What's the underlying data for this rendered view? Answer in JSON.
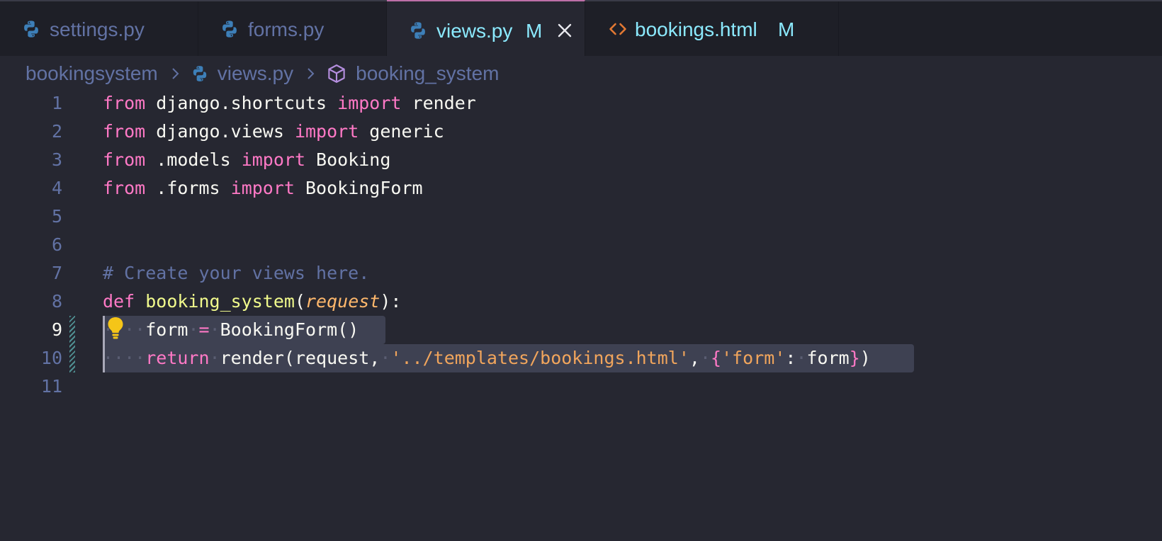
{
  "tabs": [
    {
      "label": "settings.py",
      "modified": "",
      "icon": "python-icon",
      "active": false
    },
    {
      "label": "forms.py",
      "modified": "",
      "icon": "python-icon",
      "active": false
    },
    {
      "label": "views.py",
      "modified": "M",
      "icon": "python-icon",
      "active": true
    },
    {
      "label": "bookings.html",
      "modified": "M",
      "icon": "html-icon",
      "active": false
    }
  ],
  "breadcrumb": {
    "folder": "bookingsystem",
    "file": "views.py",
    "symbol": "booking_system"
  },
  "editor": {
    "language": "python",
    "current_line": 9,
    "line_numbers": [
      "1",
      "2",
      "3",
      "4",
      "5",
      "6",
      "7",
      "8",
      "9",
      "10",
      "11"
    ],
    "code": {
      "l1": {
        "kw1": "from",
        "mod": " django.shortcuts ",
        "kw2": "import",
        "name": " render"
      },
      "l2": {
        "kw1": "from",
        "mod": " django.views ",
        "kw2": "import",
        "name": " generic"
      },
      "l3": {
        "kw1": "from",
        "mod": " .models ",
        "kw2": "import",
        "name": " Booking"
      },
      "l4": {
        "kw1": "from",
        "mod": " .forms ",
        "kw2": "import",
        "name": " BookingForm"
      },
      "l7": {
        "comment": "# Create your views here."
      },
      "l8": {
        "kw": "def",
        "fn": "booking_system",
        "open": "(",
        "param": "request",
        "close": "):"
      },
      "l9": {
        "indent": "····",
        "var": "form",
        "sp1": "·",
        "op": "=",
        "sp2": "·",
        "call": "BookingForm()"
      },
      "l10": {
        "indent": "····",
        "kw": "return",
        "sp1": "·",
        "call": "render(request,",
        "sp2": "·",
        "str": "'../templates/bookings.html'",
        "comma": ",",
        "sp3": "·",
        "lbrace": "{",
        "key": "'form'",
        "colon": ":",
        "sp4": "·",
        "val": "form",
        "rbrace": "}",
        "end": ")"
      }
    }
  },
  "colors": {
    "background": "#262731",
    "tabbar": "#1e1f27",
    "keyword": "#ff79c6",
    "function": "#f1fa8c",
    "string": "#f1a55c",
    "comment": "#6272a4",
    "accent_cyan": "#8be9fd"
  }
}
